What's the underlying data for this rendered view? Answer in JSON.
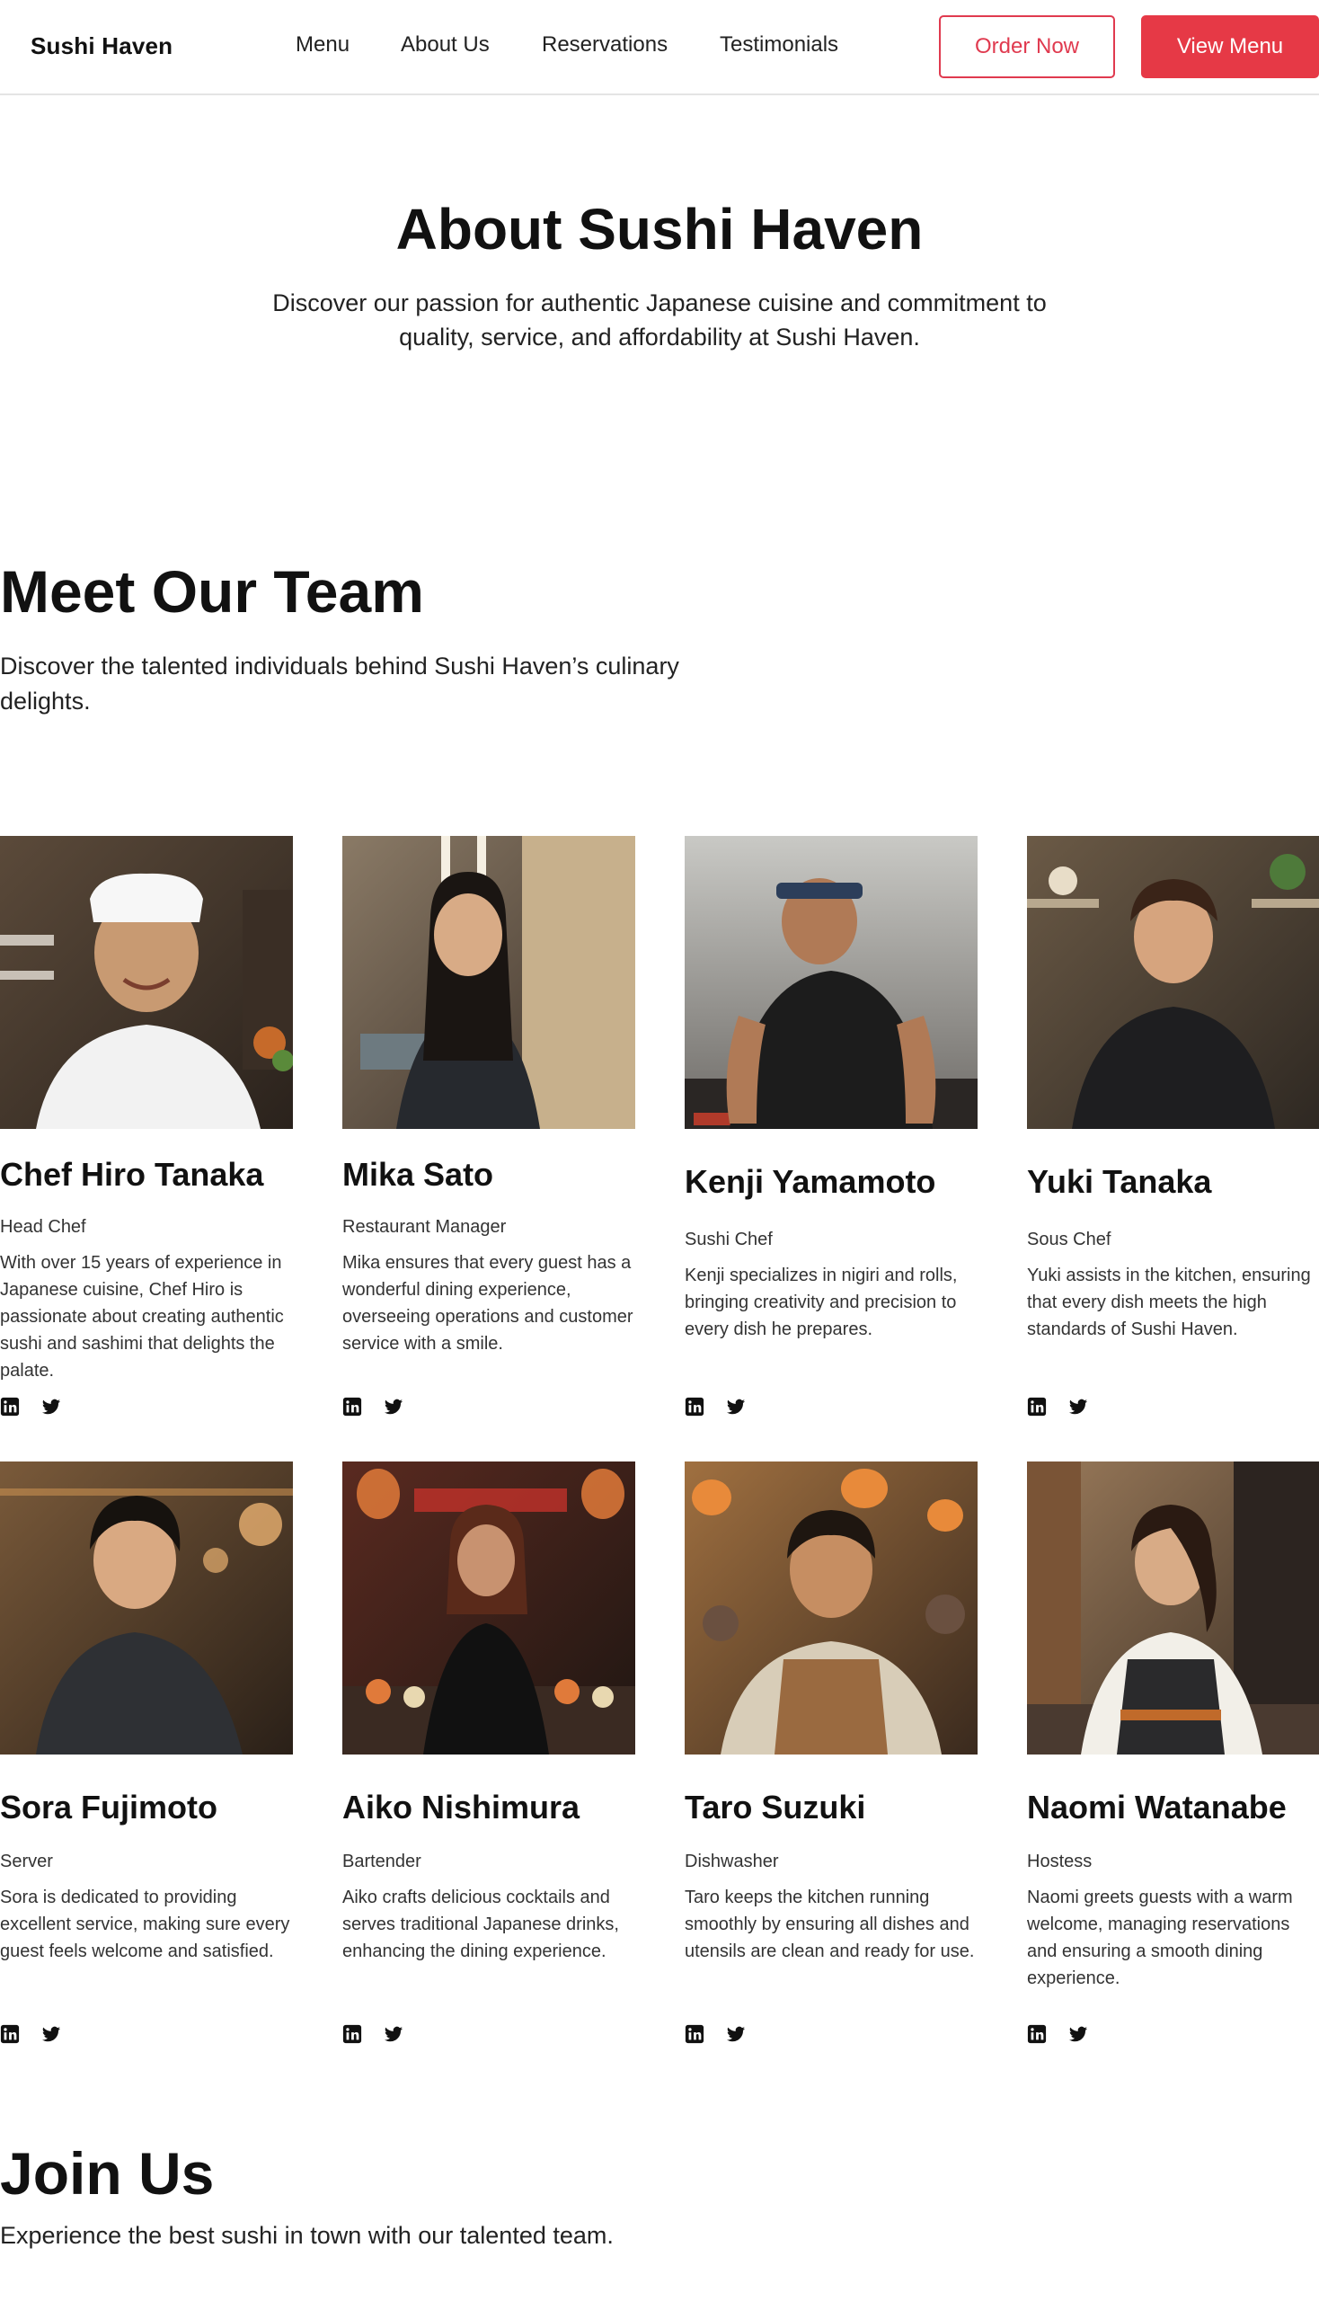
{
  "nav": {
    "logo": "Sushi Haven",
    "links": [
      "Menu",
      "About Us",
      "Reservations",
      "Testimonials"
    ],
    "order_button": "Order Now",
    "view_menu_button": "View Menu"
  },
  "hero": {
    "title": "About Sushi Haven",
    "subtitle": "Discover our passion for authentic Japanese cuisine and commitment to quality, service, and affordability at Sushi Haven."
  },
  "team": {
    "title": "Meet Our Team",
    "subtitle": "Discover the talented individuals behind Sushi Haven’s culinary delights.",
    "members": [
      {
        "name": "Chef Hiro Tanaka",
        "role": "Head Chef",
        "bio": "With over 15 years of experience in Japanese cuisine, Chef Hiro is passionate about creating authentic sushi and sashimi that delights the palate."
      },
      {
        "name": "Mika Sato",
        "role": "Restaurant Manager",
        "bio": "Mika ensures that every guest has a wonderful dining experience, overseeing operations and customer service with a smile."
      },
      {
        "name": "Kenji Yamamoto",
        "role": "Sushi Chef",
        "bio": "Kenji specializes in nigiri and rolls, bringing creativity and precision to every dish he prepares."
      },
      {
        "name": "Yuki Tanaka",
        "role": "Sous Chef",
        "bio": "Yuki assists in the kitchen, ensuring that every dish meets the high standards of Sushi Haven."
      },
      {
        "name": "Sora Fujimoto",
        "role": "Server",
        "bio": "Sora is dedicated to providing excellent service, making sure every guest feels welcome and satisfied."
      },
      {
        "name": "Aiko Nishimura",
        "role": "Bartender",
        "bio": "Aiko crafts delicious cocktails and serves traditional Japanese drinks, enhancing the dining experience."
      },
      {
        "name": "Taro Suzuki",
        "role": "Dishwasher",
        "bio": "Taro keeps the kitchen running smoothly by ensuring all dishes and utensils are clean and ready for use."
      },
      {
        "name": "Naomi Watanabe",
        "role": "Hostess",
        "bio": "Naomi greets guests with a warm welcome, managing reservations and ensuring a smooth dining experience."
      }
    ]
  },
  "join": {
    "title": "Join Us",
    "subtitle": "Experience the best sushi in town with our talented team."
  },
  "icons": [
    "linkedin-icon",
    "twitter-icon"
  ],
  "colors": {
    "accent": "#e63946",
    "accent_outline": "#e03a4f"
  }
}
